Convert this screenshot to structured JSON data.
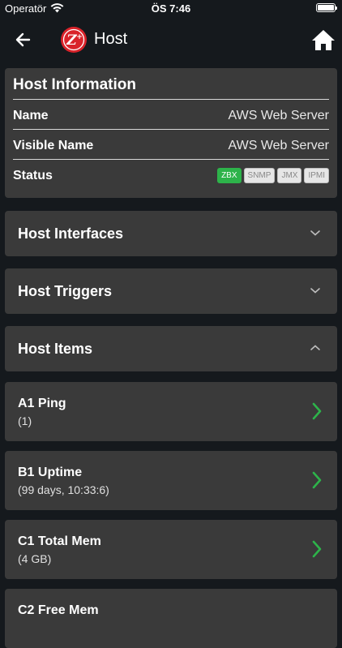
{
  "status_bar": {
    "carrier": "Operatör",
    "time": "ÖS 7:46"
  },
  "nav": {
    "title": "Host"
  },
  "host_info": {
    "title": "Host Information",
    "rows": [
      {
        "label": "Name",
        "value": "AWS Web Server"
      },
      {
        "label": "Visible Name",
        "value": "AWS Web Server"
      }
    ],
    "status_label": "Status",
    "badges": [
      "ZBX",
      "SNMP",
      "JMX",
      "IPMI"
    ]
  },
  "sections": {
    "interfaces": "Host Interfaces",
    "triggers": "Host Triggers",
    "items": "Host Items"
  },
  "items": [
    {
      "name": "A1 Ping",
      "value": "(1)"
    },
    {
      "name": "B1 Uptime",
      "value": "(99 days, 10:33:6)"
    },
    {
      "name": "C1 Total Mem",
      "value": "(4 GB)"
    },
    {
      "name": "C2 Free Mem",
      "value": ""
    }
  ],
  "colors": {
    "accent_green": "#2db34a",
    "card": "#3a3a3a",
    "background": "#15191d"
  }
}
